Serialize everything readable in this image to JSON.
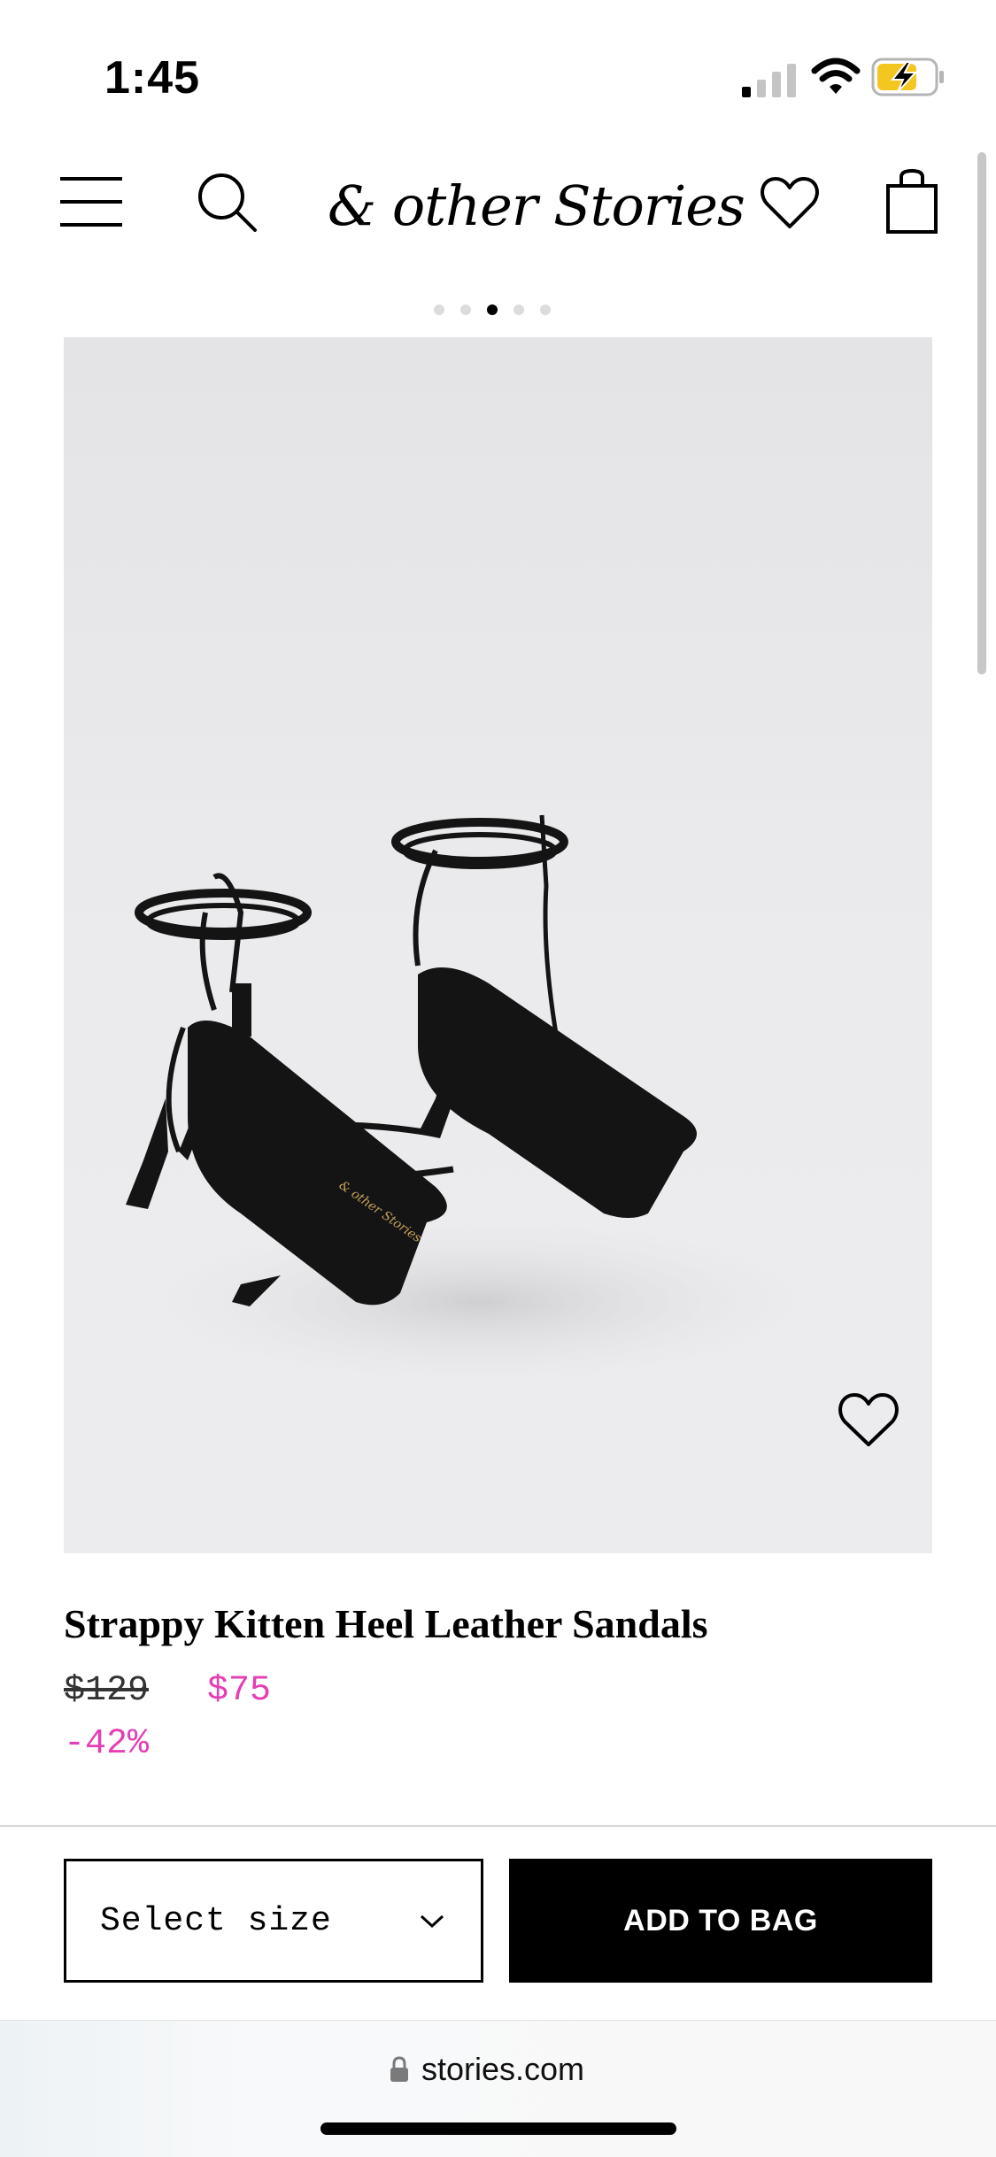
{
  "status_bar": {
    "time": "1:45",
    "icons": [
      "cellular-signal-icon",
      "wifi-icon",
      "battery-charging-icon"
    ]
  },
  "header": {
    "brand": "& other Stories",
    "icons": [
      "menu-icon",
      "search-icon",
      "heart-icon",
      "shopping-bag-icon"
    ]
  },
  "carousel": {
    "total": 5,
    "active_index": 3
  },
  "product": {
    "name": "Strappy Kitten Heel Leather Sandals",
    "price_original": "$129",
    "price_sale": "$75",
    "discount": "-42%"
  },
  "purchase": {
    "size_placeholder": "Select size",
    "add_to_bag": "ADD TO BAG"
  },
  "browser": {
    "url": "stories.com"
  },
  "colors": {
    "sale": "#e43fb5",
    "button_bg": "#000000",
    "image_bg": "#e9e9eb"
  }
}
